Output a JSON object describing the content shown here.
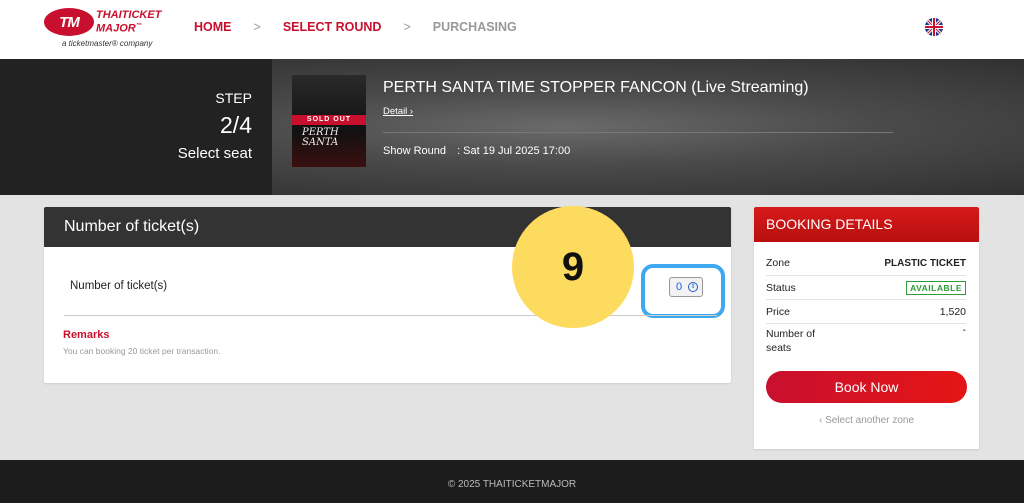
{
  "header": {
    "logo_badge": "TM",
    "logo_name": "THAITICKET MAJOR",
    "logo_tm": "™",
    "logo_sub": "a ticketmaster® company",
    "nav": {
      "home": "HOME",
      "sep1": ">",
      "select_round": "SELECT ROUND",
      "sep2": ">",
      "purchasing": "PURCHASING"
    },
    "language_flag": "uk-flag-icon"
  },
  "banner": {
    "step_label": "STEP",
    "step_number": "2/4",
    "step_description": "Select seat",
    "poster_badge": "SOLD OUT",
    "poster_title": "PERTH SANTA",
    "event_title": "PERTH SANTA TIME STOPPER FANCON (Live Streaming)",
    "detail_link": "Detail ›",
    "show_round_label": "Show Round",
    "show_round_value": ": Sat 19 Jul 2025 17:00"
  },
  "ticket_card": {
    "heading": "Number of ticket(s)",
    "row_label": "Number of ticket(s)",
    "quantity_value": "0",
    "remarks_title": "Remarks",
    "remarks_text": "You can booking 20 ticket per transaction."
  },
  "overlay": {
    "step_badge": "9"
  },
  "booking": {
    "heading": "BOOKING DETAILS",
    "zone_label": "Zone",
    "zone_value": "PLASTIC TICKET",
    "status_label": "Status",
    "status_value": "AVAILABLE",
    "price_label": "Price",
    "price_value": "1,520",
    "seats_label_1": "Number of",
    "seats_label_2": "seats",
    "seats_value": "-",
    "book_button": "Book Now",
    "another_zone": "‹  Select another zone"
  },
  "footer": {
    "copyright": "© 2025 THAITICKETMAJOR"
  },
  "colors": {
    "brand_red": "#c8102e",
    "dark_header": "#333333",
    "highlight_blue": "#3ea8f0",
    "step_yellow": "#fddb5f",
    "status_green": "#2e9b3a"
  }
}
